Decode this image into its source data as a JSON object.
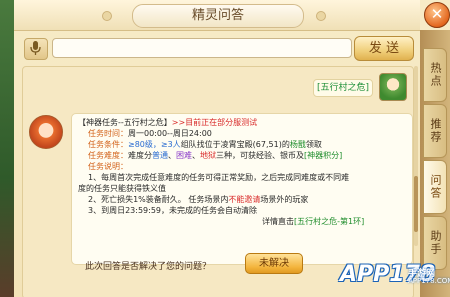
{
  "window": {
    "title": "精灵问答",
    "close_label": "✕"
  },
  "input": {
    "value": "",
    "placeholder": "",
    "send_label": "发 送"
  },
  "chat": {
    "user_question": "[五行村之危]",
    "answer": {
      "line1_task": "【神器任务--五行村之危】",
      "line1_note": ">>目前正在部分服测试",
      "time_label": "任务时间：",
      "time_value": "周一00:00--周日24:00",
      "cond_label": "任务条件：",
      "cond_value": "≥80级，≥3人",
      "cond_tail": "组队找位于凌霄宝殿(67,51)的",
      "cond_npc": "杨戬",
      "cond_end": "领取",
      "diff_label": "任务难度：",
      "diff_pre": "难度分",
      "diff_easy": "普通",
      "diff_sep1": "、",
      "diff_hard": "困难",
      "diff_sep2": "、",
      "diff_hell": "地狱",
      "diff_post": "三种，可获经验、银币及",
      "diff_reward": "[神器积分]",
      "desc_label": "任务说明：",
      "desc1": "1、每周首次完成任意难度的任务可得正常奖励，之后完成同难度或不同难",
      "desc1b": "度的任务只能获得铁义值",
      "desc2_pre": "2、死亡损失1%装备耐久。  任务场景内",
      "desc2_red": "不能邀请",
      "desc2_post": "场景外的玩家",
      "desc3": "3、到周日23:59:59，未完成的任务会自动清除",
      "detail_pre": "详情直击",
      "detail_link": "[五行村之危-第1环]"
    },
    "feedback_question": "此次回答是否解决了您的问题？",
    "unresolved_label": "未解决"
  },
  "side_tabs": [
    {
      "label": "热点"
    },
    {
      "label": "推荐"
    },
    {
      "label": "问答"
    },
    {
      "label": "助手"
    }
  ],
  "watermark": {
    "main": "APP178",
    "sub": "手游网",
    "url": "APP178.COM"
  },
  "colors": {
    "accent": "#d3621a",
    "link": "#1f8d2c",
    "warning": "#d92b2b"
  }
}
